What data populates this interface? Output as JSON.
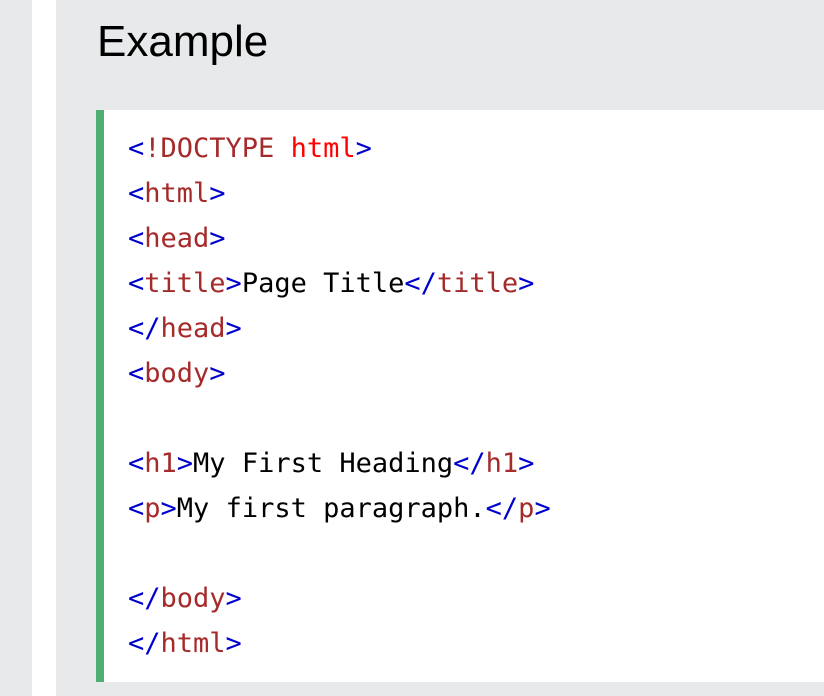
{
  "example": {
    "title": "Example",
    "colors": {
      "panel_background": "#e7e9eb",
      "accent_border": "#4fae73",
      "bracket": "#0000cd",
      "tag": "#a52a2a",
      "attribute": "#ff0000",
      "text": "#000000"
    },
    "code_lines": [
      [
        {
          "text": "<",
          "kind": "bracket"
        },
        {
          "text": "!DOCTYPE",
          "kind": "tag"
        },
        {
          "text": " html",
          "kind": "attr"
        },
        {
          "text": ">",
          "kind": "bracket"
        }
      ],
      [
        {
          "text": "<",
          "kind": "bracket"
        },
        {
          "text": "html",
          "kind": "tag"
        },
        {
          "text": ">",
          "kind": "bracket"
        }
      ],
      [
        {
          "text": "<",
          "kind": "bracket"
        },
        {
          "text": "head",
          "kind": "tag"
        },
        {
          "text": ">",
          "kind": "bracket"
        }
      ],
      [
        {
          "text": "<",
          "kind": "bracket"
        },
        {
          "text": "title",
          "kind": "tag"
        },
        {
          "text": ">",
          "kind": "bracket"
        },
        {
          "text": "Page Title",
          "kind": "text"
        },
        {
          "text": "</",
          "kind": "bracket"
        },
        {
          "text": "title",
          "kind": "tag"
        },
        {
          "text": ">",
          "kind": "bracket"
        }
      ],
      [
        {
          "text": "</",
          "kind": "bracket"
        },
        {
          "text": "head",
          "kind": "tag"
        },
        {
          "text": ">",
          "kind": "bracket"
        }
      ],
      [
        {
          "text": "<",
          "kind": "bracket"
        },
        {
          "text": "body",
          "kind": "tag"
        },
        {
          "text": ">",
          "kind": "bracket"
        }
      ],
      [],
      [
        {
          "text": "<",
          "kind": "bracket"
        },
        {
          "text": "h1",
          "kind": "tag"
        },
        {
          "text": ">",
          "kind": "bracket"
        },
        {
          "text": "My First Heading",
          "kind": "text"
        },
        {
          "text": "</",
          "kind": "bracket"
        },
        {
          "text": "h1",
          "kind": "tag"
        },
        {
          "text": ">",
          "kind": "bracket"
        }
      ],
      [
        {
          "text": "<",
          "kind": "bracket"
        },
        {
          "text": "p",
          "kind": "tag"
        },
        {
          "text": ">",
          "kind": "bracket"
        },
        {
          "text": "My first paragraph.",
          "kind": "text"
        },
        {
          "text": "</",
          "kind": "bracket"
        },
        {
          "text": "p",
          "kind": "tag"
        },
        {
          "text": ">",
          "kind": "bracket"
        }
      ],
      [],
      [
        {
          "text": "</",
          "kind": "bracket"
        },
        {
          "text": "body",
          "kind": "tag"
        },
        {
          "text": ">",
          "kind": "bracket"
        }
      ],
      [
        {
          "text": "</",
          "kind": "bracket"
        },
        {
          "text": "html",
          "kind": "tag"
        },
        {
          "text": ">",
          "kind": "bracket"
        }
      ]
    ]
  }
}
